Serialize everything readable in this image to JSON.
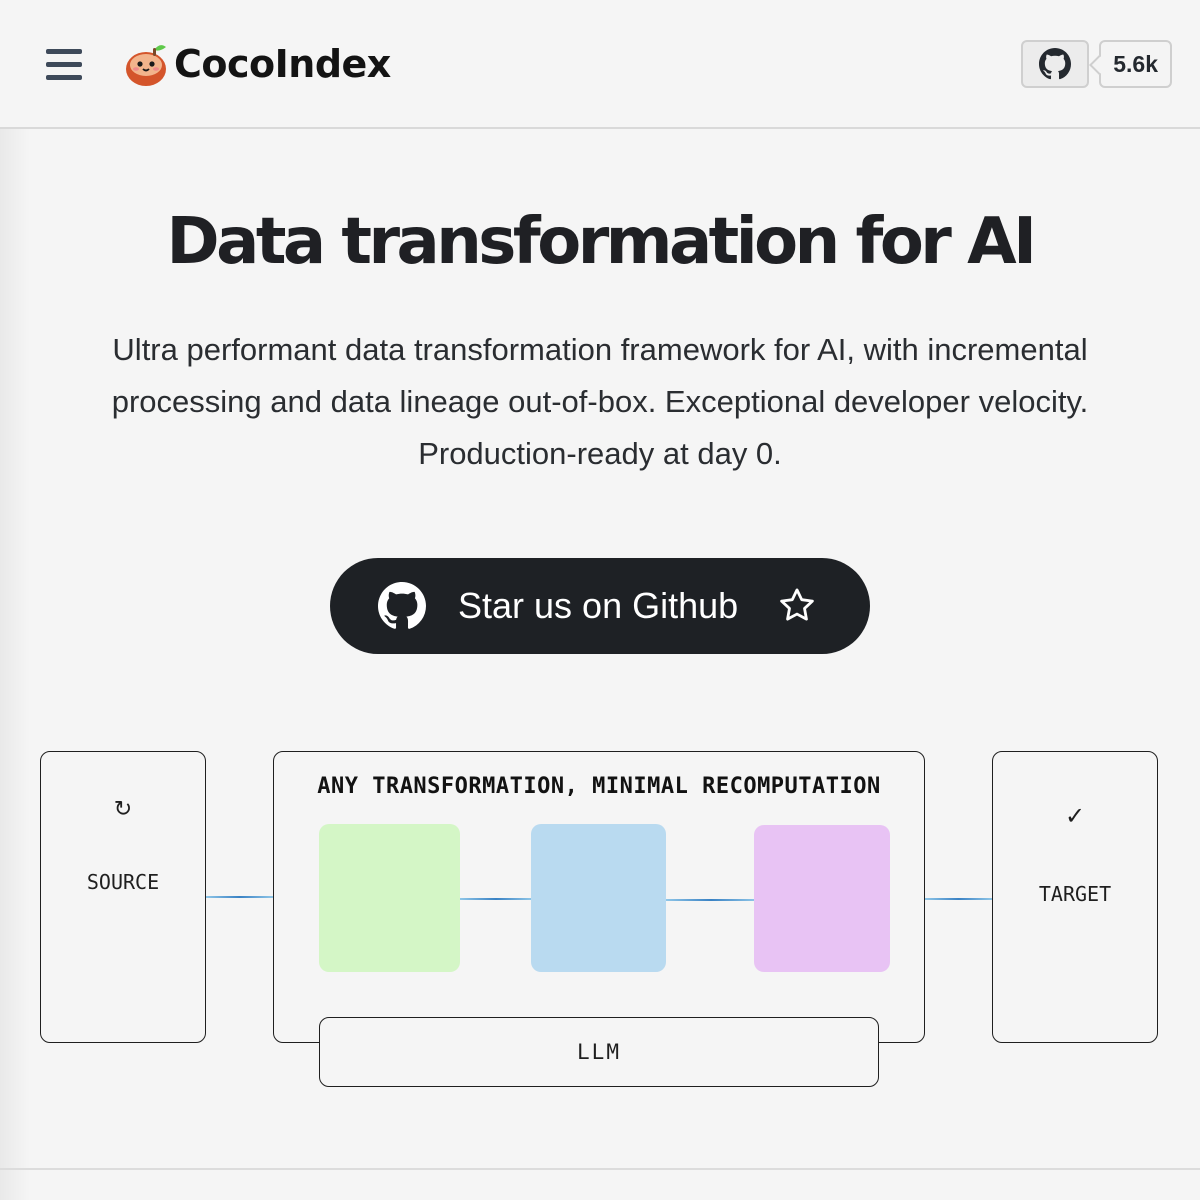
{
  "header": {
    "brand": "CocoIndex",
    "github_stars": "5.6k",
    "icons": {
      "menu": "hamburger-menu-icon",
      "github": "github-icon",
      "logo": "coconut-logo-icon"
    }
  },
  "hero": {
    "title": "Data transformation for AI",
    "subtitle_lines": [
      "Ultra performant data transformation framework for AI, with incremental",
      "processing and data lineage out-of-box. Exceptional developer velocity.",
      "Production-ready at day 0."
    ],
    "cta_label": "Star us on Github"
  },
  "diagram": {
    "source": {
      "icon": "↻",
      "label": "SOURCE"
    },
    "transform_title": "ANY TRANSFORMATION, MINIMAL RECOMPUTATION",
    "target": {
      "icon": "✓",
      "label": "TARGET"
    },
    "llm_label": "LLM",
    "tile_colors": [
      "#d4f6c6",
      "#b9daf0",
      "#e8c3f4"
    ],
    "line_color": "#3a82c4"
  },
  "colors": {
    "accent_dark": "#1e2125",
    "background": "#f5f5f5"
  }
}
